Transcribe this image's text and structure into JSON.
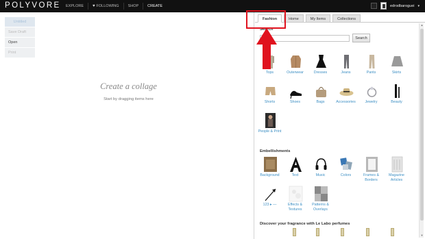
{
  "topbar": {
    "logo": "POLYVORE",
    "nav": [
      "EXPLORE",
      "FOLLOWING",
      "SHOP",
      "CREATE"
    ],
    "active_nav": "CREATE",
    "username": "edrodbaroguei"
  },
  "left_panel": {
    "items": [
      "Untitled",
      "Save Draft",
      "Open",
      "Print"
    ]
  },
  "canvas": {
    "title": "Create a collage",
    "subtitle": "Start by dragging items here"
  },
  "right_panel": {
    "tabs": [
      "Fashion",
      "Home",
      "My Items",
      "Collections"
    ],
    "active_tab": "Fashion",
    "search": {
      "label": "Search",
      "placeholder": "",
      "button": "Search"
    },
    "fashion_categories": [
      "Tops",
      "Outerwear",
      "Dresses",
      "Jeans",
      "Pants",
      "Skirts",
      "Shorts",
      "Shoes",
      "Bags",
      "Accessories",
      "Jewelry",
      "Beauty",
      "People & Print"
    ],
    "embellishments_label": "Embellishments",
    "embellishments": [
      "Background",
      "Text",
      "Music",
      "Colors",
      "Frames & Borders",
      "Magazine Articles",
      "123 ▸ —",
      "Effects & Textures",
      "Patterns & Overlays"
    ],
    "promo_label": "Discover your fragrance with Le Labo perfumes"
  },
  "colors": {
    "topbar_bg": "#111111",
    "link_blue": "#3d8fc4",
    "annotation_red": "#e0121e"
  }
}
